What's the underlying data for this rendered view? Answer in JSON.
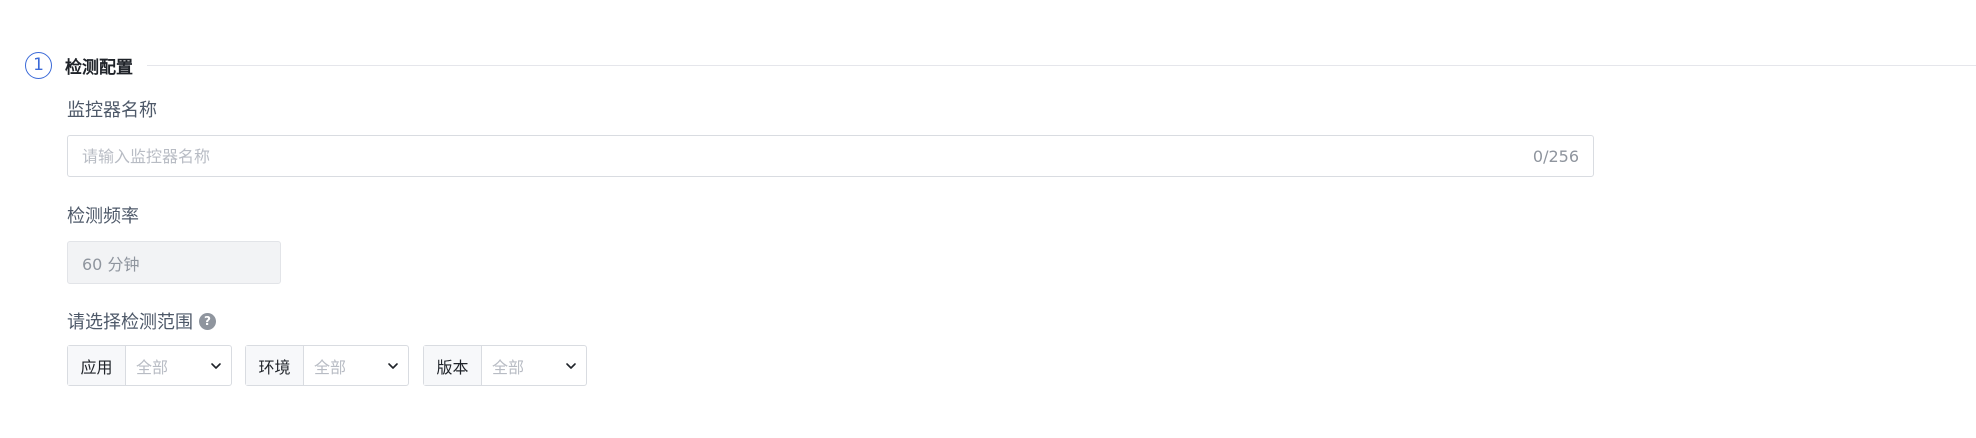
{
  "step": {
    "number": "1",
    "title": "检测配置"
  },
  "monitor_name": {
    "label": "监控器名称",
    "placeholder": "请输入监控器名称",
    "value": "",
    "char_count": "0/256"
  },
  "frequency": {
    "label": "检测频率",
    "value": "60 分钟"
  },
  "scope": {
    "label": "请选择检测范围",
    "help_icon": "question-circle-icon",
    "selects": [
      {
        "prefix": "应用",
        "value": "全部"
      },
      {
        "prefix": "环境",
        "value": "全部"
      },
      {
        "prefix": "版本",
        "value": "全部"
      }
    ]
  },
  "colors": {
    "accent": "#3b6ad8",
    "border": "#d9dce1",
    "placeholder": "#b8bcc4",
    "disabled_bg": "#f2f3f5"
  }
}
